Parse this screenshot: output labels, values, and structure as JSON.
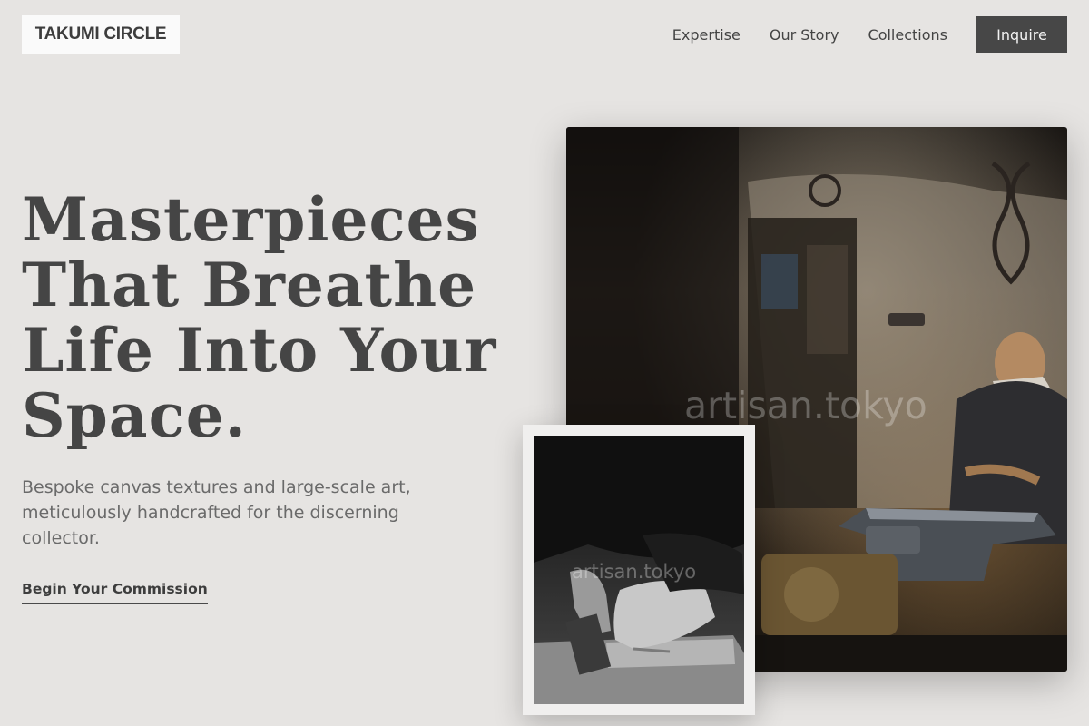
{
  "header": {
    "logo": "TAKUMI CIRCLE",
    "nav": {
      "items": [
        "Expertise",
        "Our Story",
        "Collections"
      ],
      "cta": "Inquire"
    }
  },
  "hero": {
    "headline": "Masterpieces That Breathe Life Into Your Space.",
    "subtext": "Bespoke canvas textures and large-scale art, meticulously handcrafted for the discerning collector.",
    "cta": "Begin Your Commission"
  },
  "images": {
    "main_watermark": "artisan.tokyo",
    "secondary_watermark": "artisan.tokyo"
  },
  "colors": {
    "background": "#e6e4e2",
    "button": "#474747",
    "text": "#454545"
  }
}
